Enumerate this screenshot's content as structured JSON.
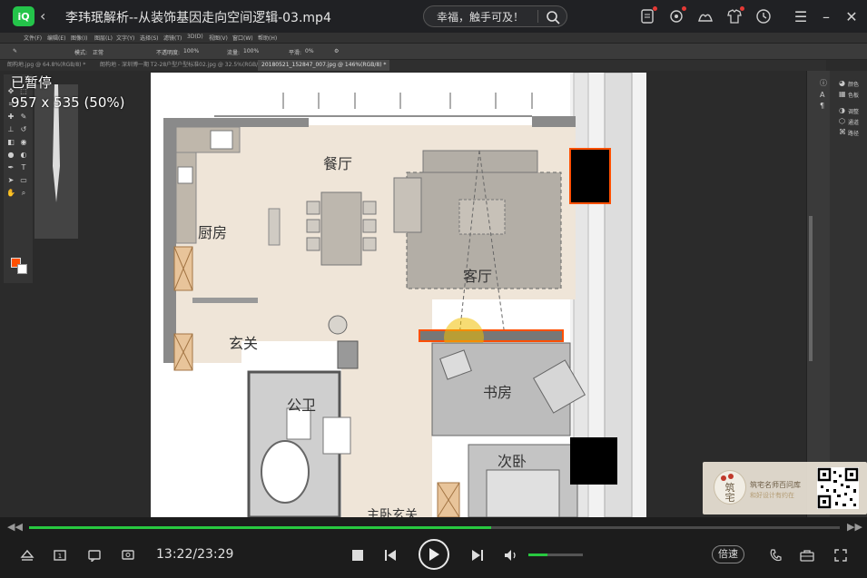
{
  "window": {
    "title": "李玮珉解析--从装饰基因走向空间逻辑-03.mp4",
    "app_logo": "iQ",
    "search_text": "幸福，触手可及！"
  },
  "colors": {
    "accent": "#28c840",
    "highlight": "#ff4f00"
  },
  "icons": {
    "back": "back-icon",
    "search": "search-icon",
    "toolbar": [
      "record-icon",
      "sync-icon",
      "skin-icon",
      "shirt-icon",
      "clock-icon"
    ],
    "window": [
      "menu-icon",
      "minimize-icon",
      "maximize-icon",
      "close-icon"
    ]
  },
  "overlay": {
    "status": "已暂停",
    "size": "957 x 535 (50%)"
  },
  "photoshop": {
    "menu": [
      "文件(F)",
      "编辑(E)",
      "图像(I)",
      "图层(L)",
      "文字(Y)",
      "选择(S)",
      "滤镜(T)",
      "3D(D)",
      "视图(V)",
      "窗口(W)",
      "帮助(H)"
    ],
    "options": {
      "mode_label": "模式:",
      "mode_value": "正常",
      "opacity_label": "不透明度:",
      "opacity_value": "100%",
      "flow_label": "流量:",
      "flow_value": "100%",
      "smooth_label": "平滑:",
      "smooth_value": "0%"
    },
    "tabs": [
      "朗构地.jpg @ 64.8%(RGB/8) *",
      "朗构地 - 深圳博一期 T2-28户型户型标准02.jpg @ 32.5%(RGB/8)",
      "20180521_152847_007.jpg @ 146%(RGB/8) *"
    ],
    "right_panels": [
      "颜色",
      "色板",
      "调整",
      "通道",
      "路径"
    ]
  },
  "plan": {
    "rooms": {
      "kitchen": "厨房",
      "dining": "餐厅",
      "living": "客厅",
      "entry": "玄关",
      "study": "书房",
      "bath": "公卫",
      "second_bedroom": "次卧",
      "master_entry": "主卧玄关"
    }
  },
  "watermark": {
    "logo_text": "筑\n宅",
    "line1": "筑宅名师百问库",
    "line2": "和好设计有约在"
  },
  "player": {
    "current_time": "13:22",
    "duration": "23:29",
    "time_display": "13:22/23:29",
    "progress": 0.57,
    "volume": 0.35,
    "speed_label": "倍速",
    "left_icons": [
      "eject-icon",
      "chapter-icon",
      "danmaku-icon",
      "screenshot-icon"
    ],
    "center_icons": [
      "stop-icon",
      "prev-icon",
      "play-icon",
      "next-icon",
      "volume-icon"
    ],
    "right_icons": [
      "phone-icon",
      "toolbox-icon",
      "fullscreen-icon"
    ]
  }
}
